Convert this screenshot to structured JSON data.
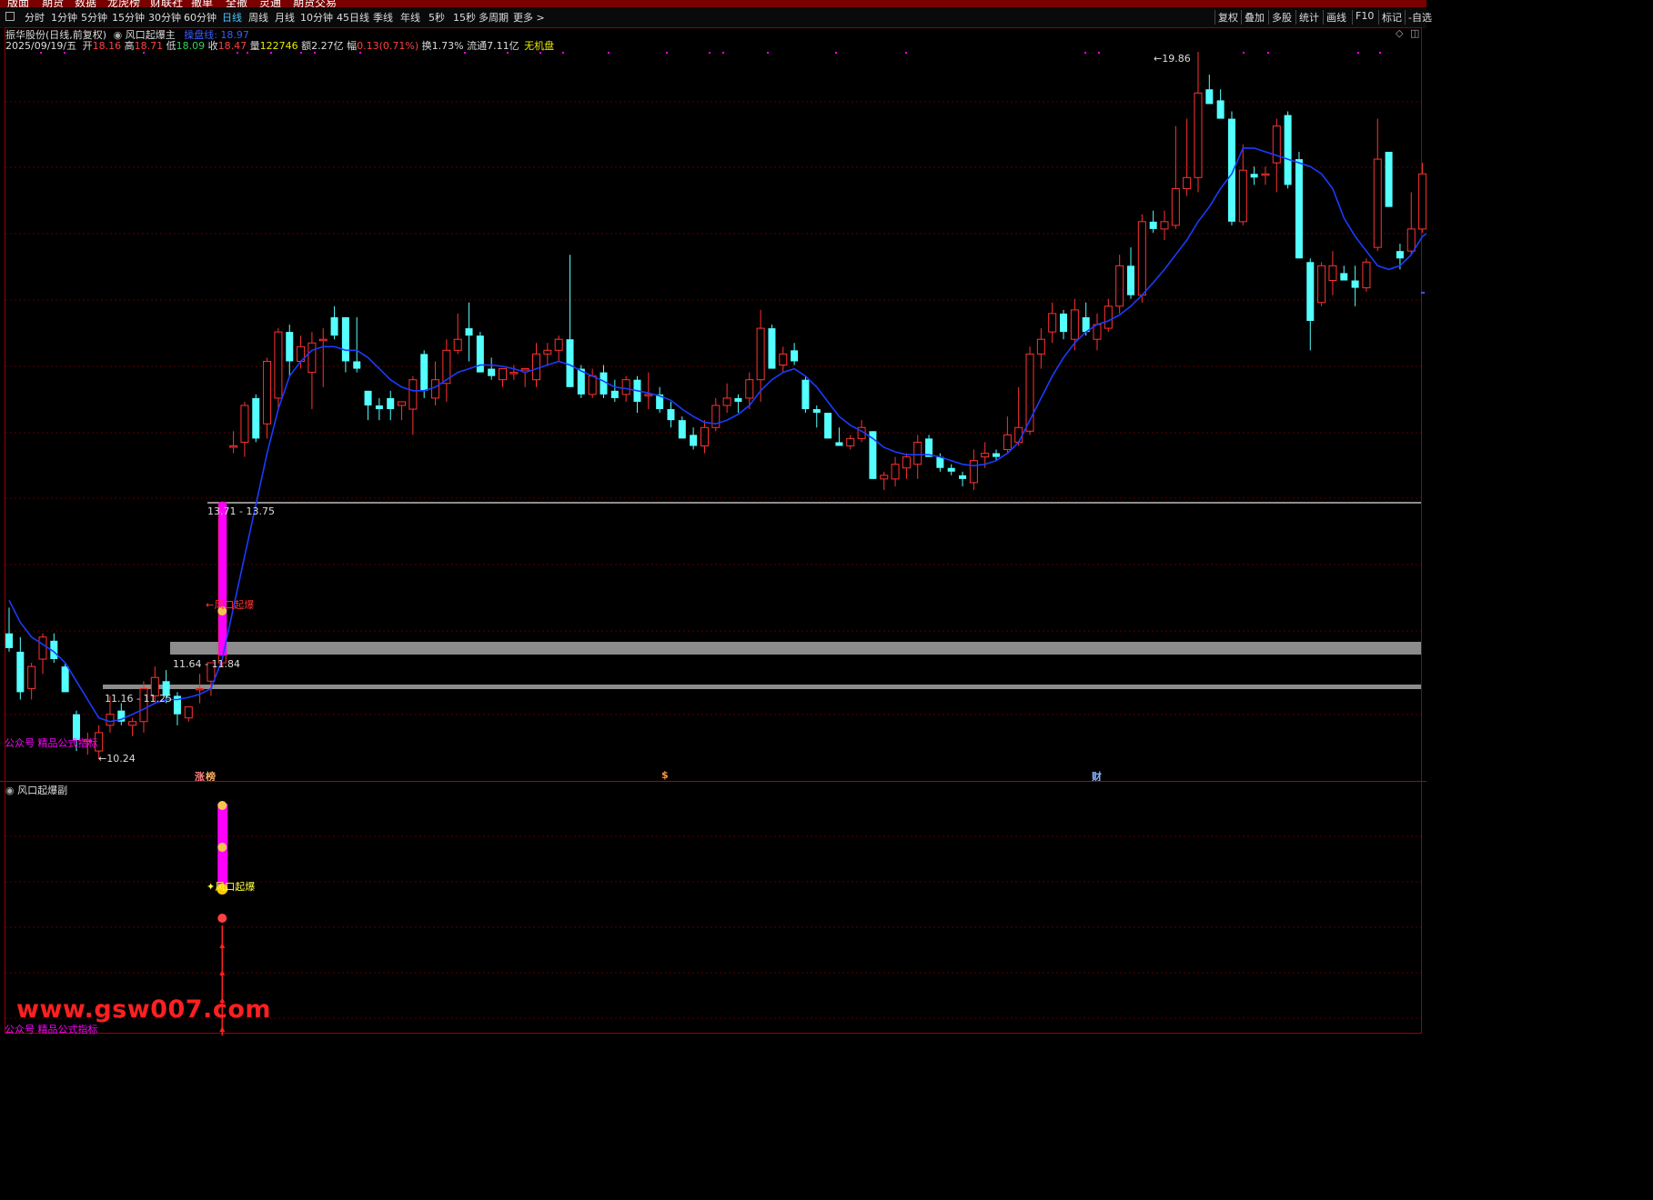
{
  "menubar": [
    "版面",
    "期货",
    "数据",
    "龙虎榜",
    "财联社",
    "撤单",
    "全撤",
    "灵通",
    "期货交易"
  ],
  "toolbar": {
    "periods": [
      "分时",
      "1分钟",
      "5分钟",
      "15分钟",
      "30分钟",
      "60分钟",
      "日线",
      "周线",
      "月线",
      "10分钟",
      "45日线",
      "季线",
      "年线",
      "5秒",
      "15秒",
      "多周期",
      "更多 >"
    ],
    "active_period": "日线",
    "right_items": [
      "复权",
      "叠加",
      "多股",
      "统计",
      "画线",
      "F10",
      "标记",
      "-自选"
    ]
  },
  "header": {
    "title": "振华股份(日线,前复权)",
    "indicator_name": "风口起爆主",
    "indicator_line_label": "操盘线: 18.97"
  },
  "quote": {
    "date": "2025/09/19/五",
    "open_label": "开",
    "open": "18.16",
    "high_label": "高",
    "high": "18.71",
    "low_label": "低",
    "low": "18.09",
    "close_label": "收",
    "close": "18.47",
    "volume_label": "量",
    "volume": "122746",
    "amount_label": "额",
    "amount": "2.27亿",
    "change_label": "幅",
    "change": "0.13(0.71%)",
    "turnover_label": "换",
    "turnover": "1.73%",
    "float_label": "流通",
    "float": "7.11亿",
    "profit": "无机盘"
  },
  "annotations": {
    "high_marker": "19.86",
    "low_marker": "10.24",
    "zone_top_label": "13.71 - 13.75",
    "zone_mid_label": "11.64 - 11.84",
    "zone_low_label": "11.16 - 11.25",
    "signal_label_main": "风口起爆",
    "signal_label_sub": "风口起爆",
    "watermark_main": "公众号 精品公式指标",
    "watermark_sub": "公众号 精品公式指标",
    "event_markers": [
      "涨",
      "榜",
      "$",
      "财"
    ]
  },
  "sub_pane": {
    "title": "风口起爆副"
  },
  "site_watermark": "www.gsw007.com",
  "colors": {
    "up": "#ff3232",
    "down": "#54ffff",
    "ma_line": "#1a3cff",
    "signal_bar": "#ff00ff",
    "grid": "#5a0000",
    "zone": "#8c8c8c"
  },
  "chart_data": {
    "type": "candlestick",
    "title": "振华股份(日线,前复权)",
    "indicator": "操盘线",
    "last_indicator_value": 18.97,
    "ylim": [
      10.0,
      20.4
    ],
    "candles": [
      {
        "o": 11.95,
        "h": 12.3,
        "l": 11.7,
        "c": 11.75
      },
      {
        "o": 11.7,
        "h": 11.9,
        "l": 11.05,
        "c": 11.15
      },
      {
        "o": 11.2,
        "h": 11.55,
        "l": 11.05,
        "c": 11.5
      },
      {
        "o": 11.6,
        "h": 11.95,
        "l": 11.4,
        "c": 11.9
      },
      {
        "o": 11.85,
        "h": 11.95,
        "l": 11.55,
        "c": 11.6
      },
      {
        "o": 11.5,
        "h": 11.55,
        "l": 11.2,
        "c": 11.15
      },
      {
        "o": 10.85,
        "h": 10.9,
        "l": 10.35,
        "c": 10.5
      },
      {
        "o": 10.5,
        "h": 10.6,
        "l": 10.3,
        "c": 10.5
      },
      {
        "o": 10.35,
        "h": 10.7,
        "l": 10.24,
        "c": 10.6
      },
      {
        "o": 10.7,
        "h": 11.1,
        "l": 10.6,
        "c": 10.85
      },
      {
        "o": 10.9,
        "h": 11.0,
        "l": 10.7,
        "c": 10.75
      },
      {
        "o": 10.7,
        "h": 10.8,
        "l": 10.55,
        "c": 10.75
      },
      {
        "o": 10.75,
        "h": 11.3,
        "l": 10.6,
        "c": 11.2
      },
      {
        "o": 11.1,
        "h": 11.5,
        "l": 11.0,
        "c": 11.35
      },
      {
        "o": 11.3,
        "h": 11.45,
        "l": 11.0,
        "c": 11.1
      },
      {
        "o": 11.1,
        "h": 11.15,
        "l": 10.7,
        "c": 10.85
      },
      {
        "o": 10.8,
        "h": 10.95,
        "l": 10.75,
        "c": 10.95
      },
      {
        "o": 11.2,
        "h": 11.4,
        "l": 11.0,
        "c": 11.2
      },
      {
        "o": 11.3,
        "h": 11.55,
        "l": 11.1,
        "c": 11.55
      },
      {
        "o": 11.55,
        "h": 13.75,
        "l": 11.5,
        "c": 13.71
      },
      {
        "o": 14.5,
        "h": 14.7,
        "l": 14.4,
        "c": 14.5
      },
      {
        "o": 14.55,
        "h": 15.1,
        "l": 14.35,
        "c": 15.05
      },
      {
        "o": 15.15,
        "h": 15.2,
        "l": 14.55,
        "c": 14.6
      },
      {
        "o": 14.8,
        "h": 15.7,
        "l": 14.6,
        "c": 15.65
      },
      {
        "o": 15.15,
        "h": 16.1,
        "l": 15.0,
        "c": 16.05
      },
      {
        "o": 16.05,
        "h": 16.15,
        "l": 15.45,
        "c": 15.65
      },
      {
        "o": 15.65,
        "h": 16.0,
        "l": 15.55,
        "c": 15.85
      },
      {
        "o": 15.5,
        "h": 16.05,
        "l": 15.0,
        "c": 15.9
      },
      {
        "o": 15.95,
        "h": 16.1,
        "l": 15.3,
        "c": 15.95
      },
      {
        "o": 16.25,
        "h": 16.4,
        "l": 15.95,
        "c": 16.0
      },
      {
        "o": 16.25,
        "h": 16.25,
        "l": 15.5,
        "c": 15.65
      },
      {
        "o": 15.65,
        "h": 16.25,
        "l": 15.5,
        "c": 15.55
      },
      {
        "o": 15.25,
        "h": 15.25,
        "l": 14.85,
        "c": 15.05
      },
      {
        "o": 15.05,
        "h": 15.15,
        "l": 14.85,
        "c": 15.0
      },
      {
        "o": 15.15,
        "h": 15.25,
        "l": 14.85,
        "c": 15.0
      },
      {
        "o": 15.05,
        "h": 15.1,
        "l": 14.85,
        "c": 15.1
      },
      {
        "o": 15.0,
        "h": 15.45,
        "l": 14.65,
        "c": 15.4
      },
      {
        "o": 15.75,
        "h": 15.8,
        "l": 15.15,
        "c": 15.25
      },
      {
        "o": 15.15,
        "h": 15.65,
        "l": 15.05,
        "c": 15.4
      },
      {
        "o": 15.35,
        "h": 15.95,
        "l": 15.1,
        "c": 15.8
      },
      {
        "o": 15.8,
        "h": 16.3,
        "l": 15.75,
        "c": 15.95
      },
      {
        "o": 16.1,
        "h": 16.45,
        "l": 15.65,
        "c": 16.0
      },
      {
        "o": 16.0,
        "h": 16.05,
        "l": 15.5,
        "c": 15.5
      },
      {
        "o": 15.55,
        "h": 15.7,
        "l": 15.4,
        "c": 15.45
      },
      {
        "o": 15.4,
        "h": 15.55,
        "l": 15.3,
        "c": 15.55
      },
      {
        "o": 15.5,
        "h": 15.6,
        "l": 15.4,
        "c": 15.5
      },
      {
        "o": 15.55,
        "h": 15.5,
        "l": 15.3,
        "c": 15.55
      },
      {
        "o": 15.4,
        "h": 15.9,
        "l": 15.3,
        "c": 15.75
      },
      {
        "o": 15.75,
        "h": 15.9,
        "l": 15.6,
        "c": 15.8
      },
      {
        "o": 15.8,
        "h": 16.0,
        "l": 15.65,
        "c": 15.95
      },
      {
        "o": 15.95,
        "h": 17.1,
        "l": 15.3,
        "c": 15.3
      },
      {
        "o": 15.55,
        "h": 15.6,
        "l": 15.15,
        "c": 15.2
      },
      {
        "o": 15.2,
        "h": 15.55,
        "l": 15.15,
        "c": 15.45
      },
      {
        "o": 15.5,
        "h": 15.6,
        "l": 15.15,
        "c": 15.2
      },
      {
        "o": 15.25,
        "h": 15.4,
        "l": 15.1,
        "c": 15.15
      },
      {
        "o": 15.2,
        "h": 15.45,
        "l": 15.1,
        "c": 15.4
      },
      {
        "o": 15.4,
        "h": 15.45,
        "l": 14.95,
        "c": 15.1
      },
      {
        "o": 15.2,
        "h": 15.5,
        "l": 15.0,
        "c": 15.2
      },
      {
        "o": 15.2,
        "h": 15.3,
        "l": 14.95,
        "c": 15.0
      },
      {
        "o": 15.0,
        "h": 15.1,
        "l": 14.75,
        "c": 14.85
      },
      {
        "o": 14.85,
        "h": 14.9,
        "l": 14.6,
        "c": 14.6
      },
      {
        "o": 14.65,
        "h": 14.75,
        "l": 14.45,
        "c": 14.5
      },
      {
        "o": 14.5,
        "h": 14.85,
        "l": 14.4,
        "c": 14.75
      },
      {
        "o": 14.75,
        "h": 15.15,
        "l": 14.7,
        "c": 15.05
      },
      {
        "o": 15.05,
        "h": 15.35,
        "l": 14.95,
        "c": 15.15
      },
      {
        "o": 15.15,
        "h": 15.2,
        "l": 14.95,
        "c": 15.1
      },
      {
        "o": 15.15,
        "h": 15.5,
        "l": 15.0,
        "c": 15.4
      },
      {
        "o": 15.4,
        "h": 16.35,
        "l": 15.1,
        "c": 16.1
      },
      {
        "o": 16.1,
        "h": 16.15,
        "l": 15.55,
        "c": 15.55
      },
      {
        "o": 15.6,
        "h": 15.85,
        "l": 15.5,
        "c": 15.75
      },
      {
        "o": 15.8,
        "h": 15.9,
        "l": 15.6,
        "c": 15.65
      },
      {
        "o": 15.4,
        "h": 15.45,
        "l": 14.95,
        "c": 15.0
      },
      {
        "o": 15.0,
        "h": 15.05,
        "l": 14.75,
        "c": 14.95
      },
      {
        "o": 14.95,
        "h": 14.95,
        "l": 14.6,
        "c": 14.6
      },
      {
        "o": 14.55,
        "h": 14.75,
        "l": 14.5,
        "c": 14.5
      },
      {
        "o": 14.5,
        "h": 14.65,
        "l": 14.45,
        "c": 14.6
      },
      {
        "o": 14.6,
        "h": 14.85,
        "l": 14.55,
        "c": 14.75
      },
      {
        "o": 14.7,
        "h": 14.7,
        "l": 14.05,
        "c": 14.05
      },
      {
        "o": 14.05,
        "h": 14.15,
        "l": 13.9,
        "c": 14.1
      },
      {
        "o": 14.05,
        "h": 14.35,
        "l": 13.95,
        "c": 14.25
      },
      {
        "o": 14.2,
        "h": 14.4,
        "l": 14.05,
        "c": 14.35
      },
      {
        "o": 14.25,
        "h": 14.65,
        "l": 14.05,
        "c": 14.55
      },
      {
        "o": 14.6,
        "h": 14.65,
        "l": 14.35,
        "c": 14.35
      },
      {
        "o": 14.35,
        "h": 14.4,
        "l": 14.15,
        "c": 14.2
      },
      {
        "o": 14.2,
        "h": 14.25,
        "l": 14.1,
        "c": 14.15
      },
      {
        "o": 14.1,
        "h": 14.15,
        "l": 13.95,
        "c": 14.05
      },
      {
        "o": 14.0,
        "h": 14.45,
        "l": 13.9,
        "c": 14.3
      },
      {
        "o": 14.35,
        "h": 14.55,
        "l": 14.2,
        "c": 14.4
      },
      {
        "o": 14.4,
        "h": 14.45,
        "l": 14.3,
        "c": 14.35
      },
      {
        "o": 14.45,
        "h": 14.9,
        "l": 14.4,
        "c": 14.65
      },
      {
        "o": 14.55,
        "h": 15.3,
        "l": 14.5,
        "c": 14.75
      },
      {
        "o": 14.7,
        "h": 15.85,
        "l": 14.65,
        "c": 15.75
      },
      {
        "o": 15.75,
        "h": 16.1,
        "l": 15.55,
        "c": 15.95
      },
      {
        "o": 16.05,
        "h": 16.45,
        "l": 15.9,
        "c": 16.3
      },
      {
        "o": 16.3,
        "h": 16.35,
        "l": 15.95,
        "c": 16.05
      },
      {
        "o": 15.95,
        "h": 16.5,
        "l": 15.8,
        "c": 16.35
      },
      {
        "o": 16.25,
        "h": 16.45,
        "l": 16.0,
        "c": 16.05
      },
      {
        "o": 15.95,
        "h": 16.3,
        "l": 15.8,
        "c": 16.15
      },
      {
        "o": 16.1,
        "h": 16.5,
        "l": 16.05,
        "c": 16.4
      },
      {
        "o": 16.4,
        "h": 17.1,
        "l": 16.3,
        "c": 16.95
      },
      {
        "o": 16.95,
        "h": 17.2,
        "l": 16.5,
        "c": 16.55
      },
      {
        "o": 16.55,
        "h": 17.65,
        "l": 16.45,
        "c": 17.55
      },
      {
        "o": 17.55,
        "h": 17.7,
        "l": 17.4,
        "c": 17.45
      },
      {
        "o": 17.45,
        "h": 17.7,
        "l": 17.3,
        "c": 17.55
      },
      {
        "o": 17.5,
        "h": 18.85,
        "l": 17.45,
        "c": 18.0
      },
      {
        "o": 18.0,
        "h": 18.95,
        "l": 17.9,
        "c": 18.15
      },
      {
        "o": 18.15,
        "h": 19.86,
        "l": 17.95,
        "c": 19.3
      },
      {
        "o": 19.35,
        "h": 19.55,
        "l": 19.2,
        "c": 19.15
      },
      {
        "o": 19.2,
        "h": 19.35,
        "l": 19.05,
        "c": 18.95
      },
      {
        "o": 18.95,
        "h": 19.05,
        "l": 17.5,
        "c": 17.55
      },
      {
        "o": 17.55,
        "h": 18.6,
        "l": 17.5,
        "c": 18.25
      },
      {
        "o": 18.2,
        "h": 18.3,
        "l": 18.05,
        "c": 18.15
      },
      {
        "o": 18.2,
        "h": 18.3,
        "l": 18.05,
        "c": 18.2
      },
      {
        "o": 18.35,
        "h": 18.95,
        "l": 17.95,
        "c": 18.85
      },
      {
        "o": 19.0,
        "h": 19.05,
        "l": 18.0,
        "c": 18.05
      },
      {
        "o": 18.4,
        "h": 18.5,
        "l": 17.05,
        "c": 17.05
      },
      {
        "o": 17.0,
        "h": 17.05,
        "l": 15.8,
        "c": 16.2
      },
      {
        "o": 16.45,
        "h": 17.0,
        "l": 16.4,
        "c": 16.95
      },
      {
        "o": 16.75,
        "h": 17.15,
        "l": 16.55,
        "c": 16.95
      },
      {
        "o": 16.85,
        "h": 16.95,
        "l": 16.75,
        "c": 16.75
      },
      {
        "o": 16.75,
        "h": 16.95,
        "l": 16.4,
        "c": 16.65
      },
      {
        "o": 16.65,
        "h": 17.05,
        "l": 16.6,
        "c": 17.0
      },
      {
        "o": 17.2,
        "h": 18.95,
        "l": 17.15,
        "c": 18.4
      },
      {
        "o": 18.5,
        "h": 18.5,
        "l": 17.8,
        "c": 17.75
      },
      {
        "o": 17.15,
        "h": 17.25,
        "l": 16.9,
        "c": 17.05
      },
      {
        "o": 17.15,
        "h": 17.95,
        "l": 17.1,
        "c": 17.45
      },
      {
        "o": 17.45,
        "h": 18.35,
        "l": 17.4,
        "c": 18.2
      },
      {
        "o": 18.16,
        "h": 18.71,
        "l": 18.09,
        "c": 18.47
      }
    ],
    "ma": [
      12.4,
      12.1,
      11.9,
      11.8,
      11.7,
      11.55,
      11.3,
      11.05,
      10.8,
      10.75,
      10.78,
      10.85,
      10.92,
      11.0,
      11.05,
      11.05,
      11.08,
      11.12,
      11.2,
      11.6,
      12.3,
      13.0,
      13.7,
      14.4,
      15.0,
      15.45,
      15.65,
      15.8,
      15.85,
      15.85,
      15.8,
      15.8,
      15.7,
      15.55,
      15.4,
      15.3,
      15.25,
      15.25,
      15.3,
      15.4,
      15.5,
      15.55,
      15.6,
      15.6,
      15.58,
      15.55,
      15.5,
      15.55,
      15.6,
      15.65,
      15.6,
      15.52,
      15.45,
      15.38,
      15.3,
      15.28,
      15.25,
      15.22,
      15.18,
      15.12,
      15.0,
      14.9,
      14.82,
      14.8,
      14.85,
      14.93,
      15.05,
      15.25,
      15.4,
      15.5,
      15.55,
      15.45,
      15.3,
      15.1,
      14.9,
      14.78,
      14.7,
      14.6,
      14.48,
      14.42,
      14.38,
      14.38,
      14.38,
      14.35,
      14.3,
      14.25,
      14.23,
      14.25,
      14.3,
      14.4,
      14.55,
      14.85,
      15.15,
      15.45,
      15.7,
      15.9,
      16.05,
      16.15,
      16.2,
      16.28,
      16.4,
      16.55,
      16.72,
      16.9,
      17.1,
      17.3,
      17.55,
      17.75,
      18.0,
      18.2,
      18.55,
      18.55,
      18.5,
      18.45,
      18.4,
      18.35,
      18.3,
      18.2,
      18.0,
      17.6,
      17.35,
      17.15,
      16.95,
      16.9,
      16.95,
      17.1,
      17.35,
      17.45,
      17.5,
      17.55,
      17.65,
      17.8
    ]
  }
}
